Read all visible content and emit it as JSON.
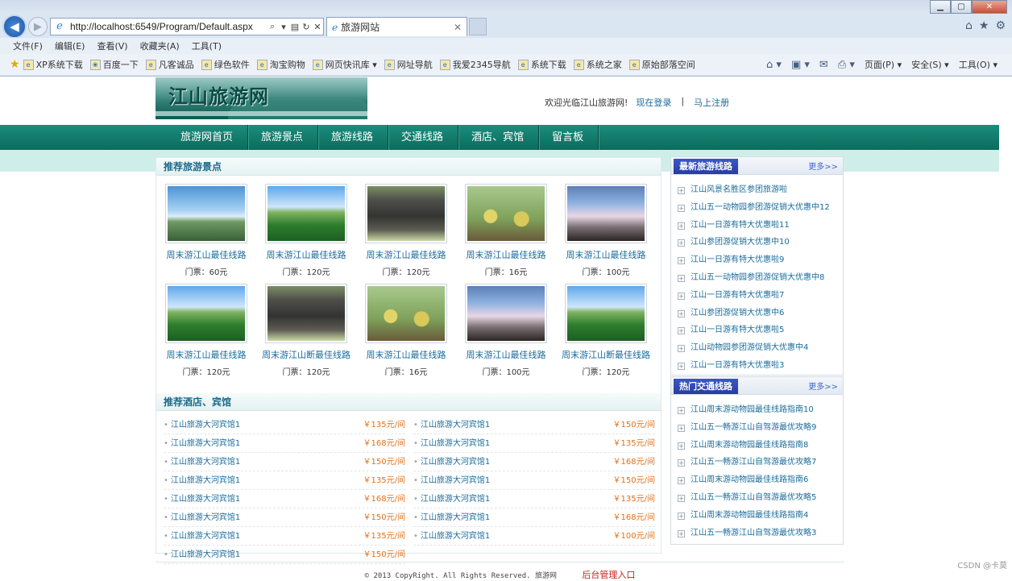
{
  "browser": {
    "url": "http://localhost:6549/Program/Default.aspx",
    "tab_title": "旅游网站",
    "menus": [
      "文件(F)",
      "编辑(E)",
      "查看(V)",
      "收藏夹(A)",
      "工具(T)"
    ],
    "favorites": [
      "XP系统下载",
      "百度一下",
      "凡客诚品",
      "绿色软件",
      "淘宝购物",
      "网页快讯库",
      "网址导航",
      "我爱2345导航",
      "系统下载",
      "系统之家",
      "原始部落空间"
    ],
    "commands": [
      "页面(P)",
      "安全(S)",
      "工具(O)"
    ],
    "win_controls": [
      "▁",
      "▢",
      "✕"
    ]
  },
  "site": {
    "logo_text": "江山旅游网",
    "welcome": "欢迎光临江山旅游网!",
    "login": "现在登录",
    "separator": "|",
    "register": "马上注册",
    "nav": [
      "旅游网首页",
      "旅游景点",
      "旅游线路",
      "交通线路",
      "酒店、宾馆",
      "留言板"
    ],
    "spots_title": "推荐旅游景点",
    "spots": [
      {
        "name": "周末游江山最佳线路",
        "price": "门票：60元",
        "img": "sky"
      },
      {
        "name": "周末游江山最佳线路",
        "price": "门票：120元",
        "img": "lotus"
      },
      {
        "name": "周末游江山最佳线路",
        "price": "门票：120元",
        "img": "gate"
      },
      {
        "name": "周末游江山最佳线路",
        "price": "门票：16元",
        "img": "fruit"
      },
      {
        "name": "周末游江山最佳线路",
        "price": "门票：100元",
        "img": "cloud"
      },
      {
        "name": "周末游江山最佳线路",
        "price": "门票：120元",
        "img": "lotus"
      },
      {
        "name": "周末游江山断最佳线路",
        "price": "门票：120元",
        "img": "gate"
      },
      {
        "name": "周末游江山最佳线路",
        "price": "门票：16元",
        "img": "fruit"
      },
      {
        "name": "周末游江山最佳线路",
        "price": "门票：100元",
        "img": "cloud"
      },
      {
        "name": "周末游江山断最佳线路",
        "price": "门票：120元",
        "img": "lotus"
      }
    ],
    "hotels_title": "推荐酒店、宾馆",
    "hotels": [
      {
        "name": "江山旅游大河宾馆1",
        "price": "￥135元/间"
      },
      {
        "name": "江山旅游大河宾馆1",
        "price": "￥150元/间"
      },
      {
        "name": "江山旅游大河宾馆1",
        "price": "￥168元/间"
      },
      {
        "name": "江山旅游大河宾馆1",
        "price": "￥135元/间"
      },
      {
        "name": "江山旅游大河宾馆1",
        "price": "￥150元/间"
      },
      {
        "name": "江山旅游大河宾馆1",
        "price": "￥168元/间"
      },
      {
        "name": "江山旅游大河宾馆1",
        "price": "￥135元/间"
      },
      {
        "name": "江山旅游大河宾馆1",
        "price": "￥150元/间"
      },
      {
        "name": "江山旅游大河宾馆1",
        "price": "￥168元/间"
      },
      {
        "name": "江山旅游大河宾馆1",
        "price": "￥135元/间"
      },
      {
        "name": "江山旅游大河宾馆1",
        "price": "￥150元/间"
      },
      {
        "name": "江山旅游大河宾馆1",
        "price": "￥168元/间"
      },
      {
        "name": "江山旅游大河宾馆1",
        "price": "￥135元/间"
      },
      {
        "name": "江山旅游大河宾馆1",
        "price": "￥100元/间"
      },
      {
        "name": "江山旅游大河宾馆1",
        "price": "￥150元/间"
      }
    ],
    "latest_title": "最新旅游线路",
    "more": "更多>>",
    "latest": [
      "江山风景名胜区参团旅游啦",
      "江山五一动物园参团游促销大优惠中12",
      "江山一日游有特大优惠啦11",
      "江山参团游促销大优惠中10",
      "江山一日游有特大优惠啦9",
      "江山五一动物园参团游促销大优惠中8",
      "江山一日游有特大优惠啦7",
      "江山参团游促销大优惠中6",
      "江山一日游有特大优惠啦5",
      "江山动物园参团游促销大优惠中4",
      "江山一日游有特大优惠啦3"
    ],
    "traffic_title": "热门交通线路",
    "traffic": [
      "江山周末游动物园最佳线路指南10",
      "江山五一畅游江山自驾游最优攻略9",
      "江山周末游动物园最佳线路指南8",
      "江山五一畅游江山自驾游最优攻略7",
      "江山周末游动物园最佳线路指南6",
      "江山五一畅游江山自驾游最优攻略5",
      "江山周末游动物园最佳线路指南4",
      "江山五一畅游江山自驾游最优攻略3"
    ],
    "footer": "© 2013 CopyRight. All Rights Reserved. 旅游网",
    "admin": "后台管理入口"
  },
  "watermark": "CSDN @卡莫"
}
